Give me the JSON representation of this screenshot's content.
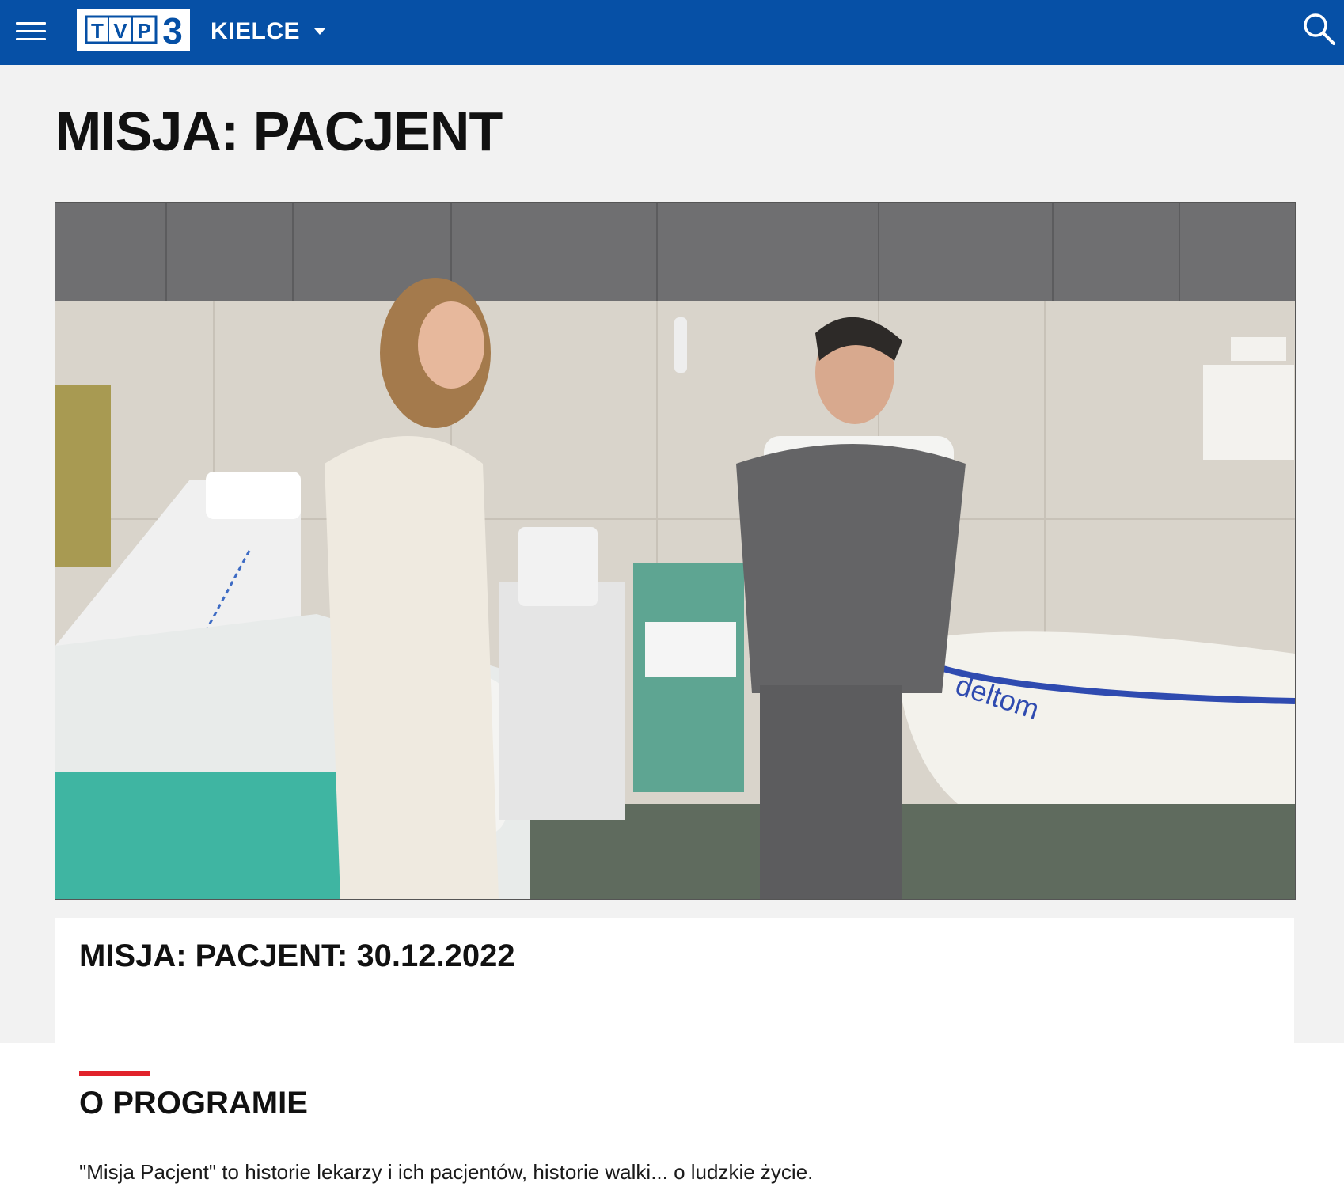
{
  "header": {
    "menu_icon": "hamburger-menu-icon",
    "logo_text": "TVP3",
    "region_label": "KIELCE",
    "region_caret_icon": "caret-down-icon",
    "search_icon": "search-icon",
    "background_color": "#0650a6"
  },
  "page": {
    "title": "MISJA: PACJENT"
  },
  "video": {
    "thumbnail_text": "deltom"
  },
  "episode": {
    "title": "MISJA: PACJENT: 30.12.2022"
  },
  "about": {
    "heading": "O PROGRAMIE",
    "description": "\"Misja Pacjent\" to historie lekarzy i ich pacjentów, historie walki... o ludzkie życie.",
    "accent_color": "#e1222b"
  }
}
